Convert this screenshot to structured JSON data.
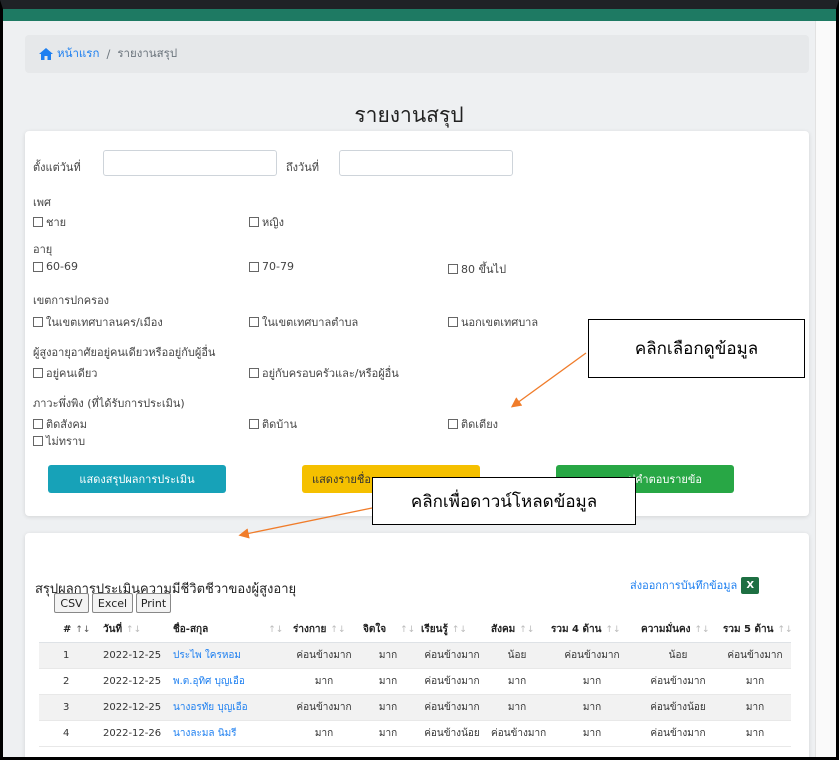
{
  "breadcrumb": {
    "home": "หน้าแรก",
    "separator": "/",
    "current": "รายงานสรุป"
  },
  "page_title": "รายงานสรุป",
  "filters": {
    "from_label": "ตั้งแต่วันที่",
    "from_value": "",
    "to_label": "ถึงวันที่",
    "to_value": "",
    "gender": {
      "label": "เพศ",
      "options": [
        "ชาย",
        "หญิง"
      ]
    },
    "age": {
      "label": "อายุ",
      "options": [
        "60-69",
        "70-79",
        "80 ขึ้นไป"
      ]
    },
    "district": {
      "label": "เขตการปกครอง",
      "options": [
        "ในเขตเทศบาลนคร/เมือง",
        "ในเขตเทศบาลตำบล",
        "นอกเขตเทศบาล"
      ]
    },
    "living": {
      "label": "ผู้สูงอายุอาศัยอยู่คนเดียวหรืออยู่กับผู้อื่น",
      "options": [
        "อยู่คนเดียว",
        "อยู่กับครอบครัวและ/หรือผู้อื่น"
      ]
    },
    "dependency": {
      "label": "ภาวะพึ่งพิง (ที่ได้รับการประเมิน)",
      "options": [
        "ติดสังคม",
        "ติดบ้าน",
        "ติดเตียง",
        "ไม่ทราบ"
      ]
    }
  },
  "buttons": {
    "summary": "แสดงสรุปผลการประเมิน",
    "names_partial": "แสดงรายชื่อ",
    "answers_partial": "ปคำตอบรายข้อ"
  },
  "callouts": {
    "select": "คลิกเลือกดูข้อมูล",
    "download": "คลิกเพื่อดาวน์โหลดข้อมูล"
  },
  "table": {
    "title": "สรุปผลการประเมินความมีชีวิตชีวาของผู้สูงอายุ",
    "export_link": "ส่งออกการบันทึกข้อมูล",
    "export_icon_text": "X",
    "dt_buttons": [
      "CSV",
      "Excel",
      "Print"
    ],
    "headers": [
      "#",
      "วันที่",
      "ชื่อ-สกุล",
      "ร่างกาย",
      "จิตใจ",
      "เรียนรู้",
      "สังคม",
      "รวม 4 ด้าน",
      "ความมั่นคง",
      "รวม 5 ด้าน"
    ],
    "rows": [
      [
        "1",
        "2022-12-25",
        "ประไพ ใครหอม",
        "ค่อนข้างมาก",
        "มาก",
        "ค่อนข้างมาก",
        "น้อย",
        "ค่อนข้างมาก",
        "น้อย",
        "ค่อนข้างมาก"
      ],
      [
        "2",
        "2022-12-25",
        "พ.ต.อุทิศ บุญเอือ",
        "มาก",
        "มาก",
        "ค่อนข้างมาก",
        "มาก",
        "มาก",
        "ค่อนข้างมาก",
        "มาก"
      ],
      [
        "3",
        "2022-12-25",
        "นางอรทัย บุญเอือ",
        "ค่อนข้างมาก",
        "มาก",
        "ค่อนข้างมาก",
        "มาก",
        "มาก",
        "ค่อนข้างน้อย",
        "มาก"
      ],
      [
        "4",
        "2022-12-26",
        "นางละมล นิมรี",
        "มาก",
        "มาก",
        "ค่อนข้างน้อย",
        "ค่อนข้างมาก",
        "มาก",
        "ค่อนข้างมาก",
        "มาก"
      ]
    ]
  },
  "colors": {
    "header_bar": "#1e7a63",
    "summary_button": "#17a2b8",
    "names_button": "#f5c000",
    "answers_button": "#28a745",
    "link": "#1d7ff0",
    "callout_arrow": "#f07c2a"
  }
}
